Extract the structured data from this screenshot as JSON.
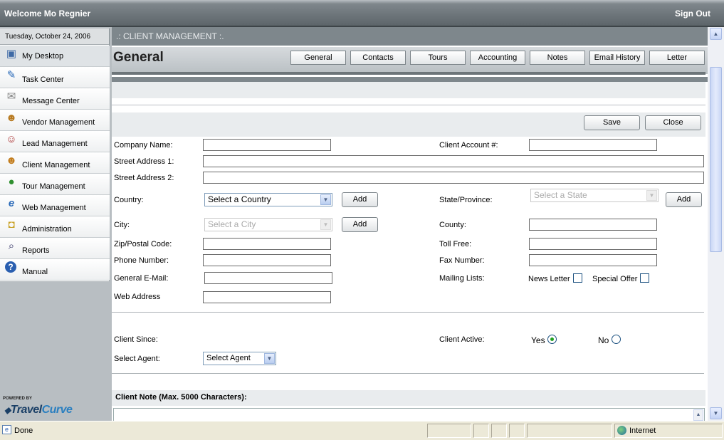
{
  "header": {
    "welcome": "Welcome Mo Regnier",
    "signout": "Sign Out"
  },
  "sidebar": {
    "date": "Tuesday, October 24, 2006",
    "items": [
      {
        "label": "My Desktop",
        "icon": "desktop-icon"
      },
      {
        "label": "Task Center",
        "icon": "task-icon"
      },
      {
        "label": "Message Center",
        "icon": "message-icon"
      },
      {
        "label": "Vendor Management",
        "icon": "vendor-icon"
      },
      {
        "label": "Lead Management",
        "icon": "lead-icon"
      },
      {
        "label": "Client Management",
        "icon": "client-icon"
      },
      {
        "label": "Tour Management",
        "icon": "globe-icon"
      },
      {
        "label": "Web Management",
        "icon": "ie-icon"
      },
      {
        "label": "Administration",
        "icon": "lock-icon"
      },
      {
        "label": "Reports",
        "icon": "magnifier-icon"
      },
      {
        "label": "Manual",
        "icon": "help-icon"
      }
    ],
    "powered_by": "POWERED BY",
    "logo_a": "Travel",
    "logo_b": "Curve"
  },
  "main": {
    "section_title": ".: CLIENT MANAGEMENT :.",
    "page_title": "General",
    "tabs": [
      "General",
      "Contacts",
      "Tours",
      "Accounting",
      "Notes",
      "Email History",
      "Letter"
    ],
    "buttons": {
      "save": "Save",
      "close": "Close",
      "add": "Add"
    },
    "form": {
      "company_name": "Company Name:",
      "client_account": "Client Account #:",
      "street1": "Street Address 1:",
      "street2": "Street Address 2:",
      "country": "Country:",
      "country_select": "Select a Country",
      "state": "State/Province:",
      "state_select": "Select a State",
      "city": "City:",
      "city_select": "Select a City",
      "county": "County:",
      "zip": "Zip/Postal Code:",
      "toll_free": "Toll Free:",
      "phone": "Phone Number:",
      "fax": "Fax Number:",
      "email": "General E-Mail:",
      "mailing_lists": "Mailing Lists:",
      "newsletter": "News Letter",
      "special_offer": "Special Offer",
      "web": "Web Address",
      "client_since": "Client Since:",
      "client_active": "Client Active:",
      "yes": "Yes",
      "no": "No",
      "select_agent_label": "Select Agent:",
      "agent_select": "Select Agent",
      "client_note": "Client Note (Max. 5000 Characters):"
    }
  },
  "status": {
    "left": "Done",
    "zone": "Internet"
  }
}
